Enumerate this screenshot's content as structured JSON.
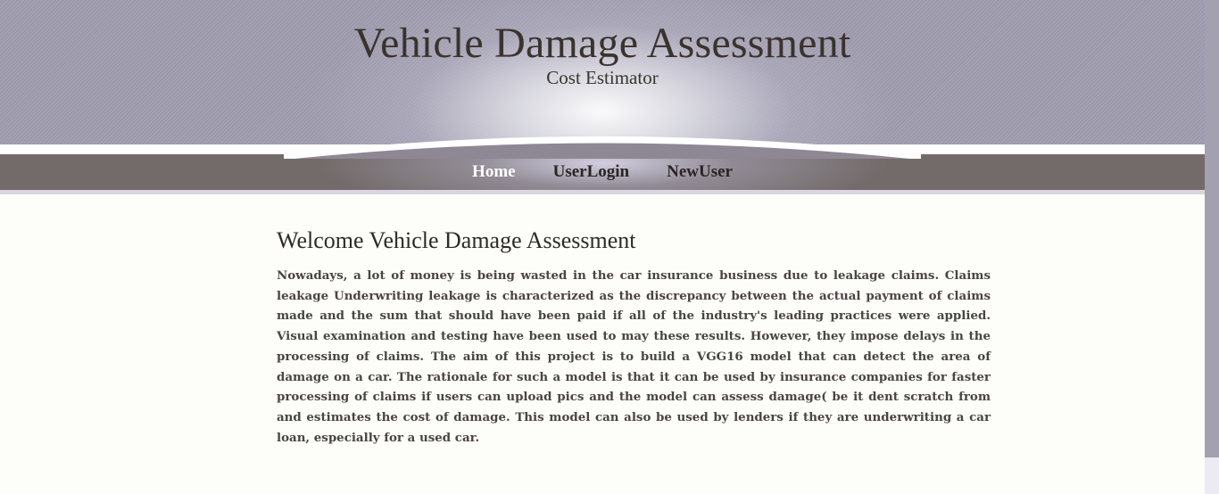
{
  "header": {
    "title": "Vehicle Damage Assessment",
    "subtitle": "Cost Estimator"
  },
  "nav": {
    "items": [
      {
        "label": "Home",
        "active": true
      },
      {
        "label": "UserLogin",
        "active": false
      },
      {
        "label": "NewUser",
        "active": false
      }
    ]
  },
  "main": {
    "heading": "Welcome Vehicle Damage Assessment",
    "body": "Nowadays, a lot of money is being wasted in the car insurance business due to leakage claims. Claims leakage Underwriting leakage is characterized as the discrepancy between the actual payment of claims made and the sum that should have been paid if all of the industry's leading practices were applied. Visual examination and testing have been used to may these results. However, they impose delays in the processing of claims. The aim of this project is to build a VGG16 model that can detect the area of damage on a car. The rationale for such a model is that it can be used by insurance companies for faster processing of claims if users can upload pics and the model can assess damage( be it dent scratch from and estimates the cost of damage. This model can also be used by lenders if they are underwriting a car loan, especially for a used car."
  },
  "colors": {
    "header_bg": "#9f9cae",
    "nav_bg": "#736b6a",
    "active_link": "#ffffff",
    "link": "#2a2424",
    "text": "#4a4444",
    "page_bg": "#fdfdf9"
  }
}
